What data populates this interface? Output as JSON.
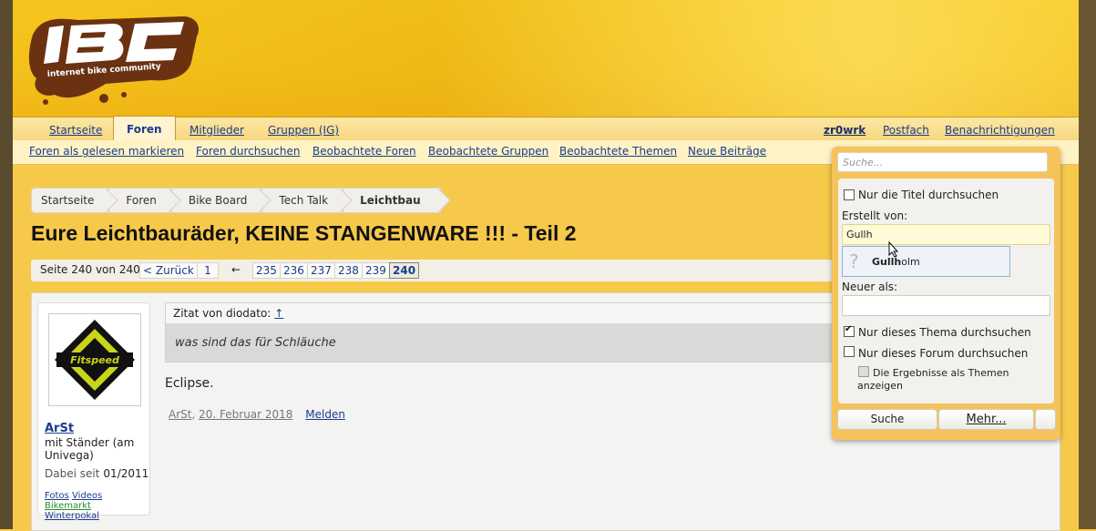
{
  "logo": {
    "text": "IBC",
    "tagline": "internet bike community"
  },
  "nav": {
    "tabs": [
      "Startseite",
      "Foren",
      "Mitglieder",
      "Gruppen (IG)"
    ],
    "active_tab": "Foren",
    "user": "zr0wrk",
    "postfach": "Postfach",
    "notifications": "Benachrichtigungen"
  },
  "subnav": [
    "Foren als gelesen markieren",
    "Foren durchsuchen",
    "Beobachtete Foren",
    "Beobachtete Gruppen",
    "Beobachtete Themen",
    "Neue Beiträge"
  ],
  "breadcrumb": [
    "Startseite",
    "Foren",
    "Bike Board",
    "Tech Talk",
    "Leichtbau"
  ],
  "thread_title": "Eure Leichtbauräder, KEINE STANGENWARE !!! - Teil 2",
  "pagination": {
    "label": "Seite 240 von 240",
    "back": "< Zurück",
    "first": "1",
    "ellipsis": "←",
    "pages": [
      "235",
      "236",
      "237",
      "238",
      "239"
    ],
    "current": "240"
  },
  "post": {
    "author": "ArSt",
    "user_title": "mit Ständer (am Univega)",
    "joined_label": "Dabei seit",
    "joined": "01/2011",
    "links": [
      "Fotos",
      "Videos",
      "Bikemarkt",
      "Winterpokal"
    ],
    "avatar_text": "Fitspeed",
    "quote_header": "Zitat von diodato:",
    "quote_arrow": "↑",
    "quote_text": "was sind das für Schläuche",
    "text": "Eclipse.",
    "meta_author": "ArSt",
    "meta_date": "20. Februar 2018",
    "report": "Melden"
  },
  "search_popup": {
    "placeholder": "Suche...",
    "only_titles": "Nur die Titel durchsuchen",
    "created_by_label": "Erstellt von:",
    "created_by_value": "Gullh",
    "suggestion_match": "Gullh",
    "suggestion_rest": "olm",
    "newer_than_label": "Neuer als:",
    "this_thread": "Nur dieses Thema durchsuchen",
    "this_forum": "Nur dieses Forum durchsuchen",
    "results_as_threads_1": "Die Ergebnisse als Themen",
    "results_as_threads_2": "anzeigen",
    "search_button": "Suche",
    "more_button": "Mehr..."
  }
}
